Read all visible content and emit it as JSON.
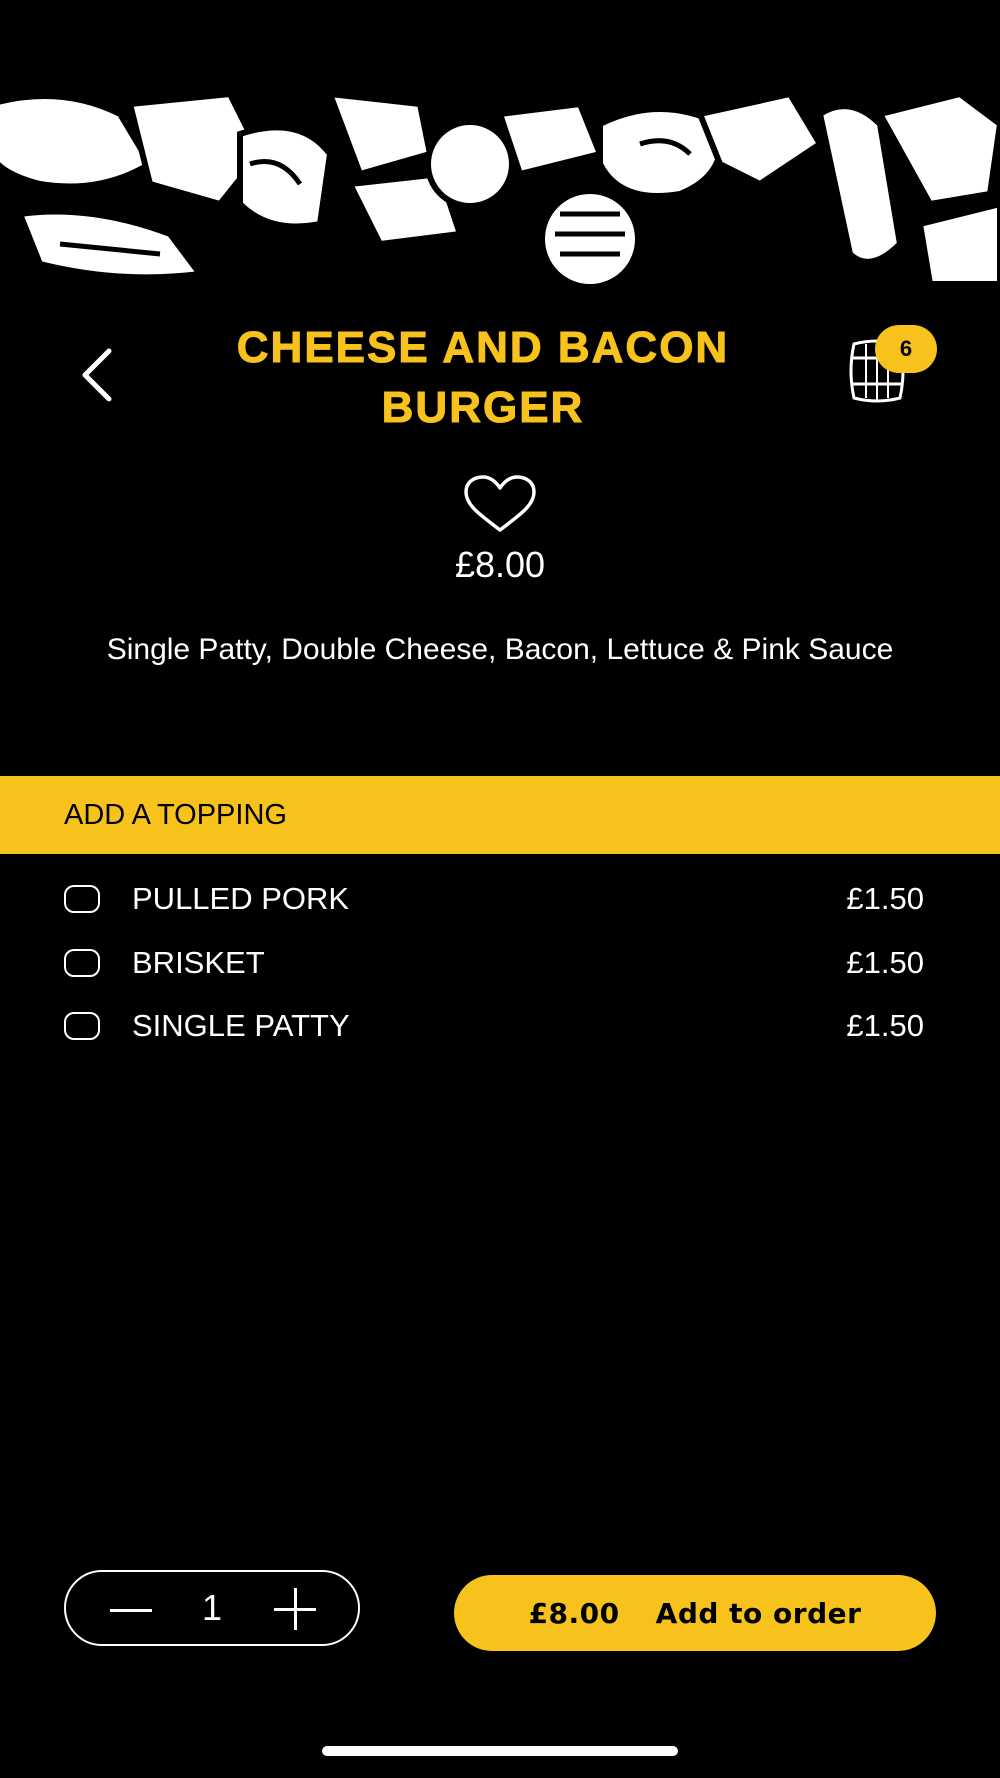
{
  "product": {
    "title": "CHEESE AND BACON BURGER",
    "price": "£8.00",
    "description": "Single Patty, Double Cheese, Bacon, Lettuce & Pink Sauce"
  },
  "cart": {
    "count": "6"
  },
  "toppings": {
    "header": "ADD A TOPPING",
    "options": [
      {
        "label": "PULLED PORK",
        "price": "£1.50"
      },
      {
        "label": "BRISKET",
        "price": "£1.50"
      },
      {
        "label": "SINGLE PATTY",
        "price": "£1.50"
      }
    ]
  },
  "order": {
    "quantity": "1",
    "total": "£8.00",
    "action_label": "Add to order"
  },
  "colors": {
    "accent": "#f8c21c",
    "background": "#000000",
    "text": "#ffffff"
  },
  "icons": {
    "back": "chevron-left-icon",
    "cart": "barrel-icon",
    "favourite": "heart-icon"
  }
}
